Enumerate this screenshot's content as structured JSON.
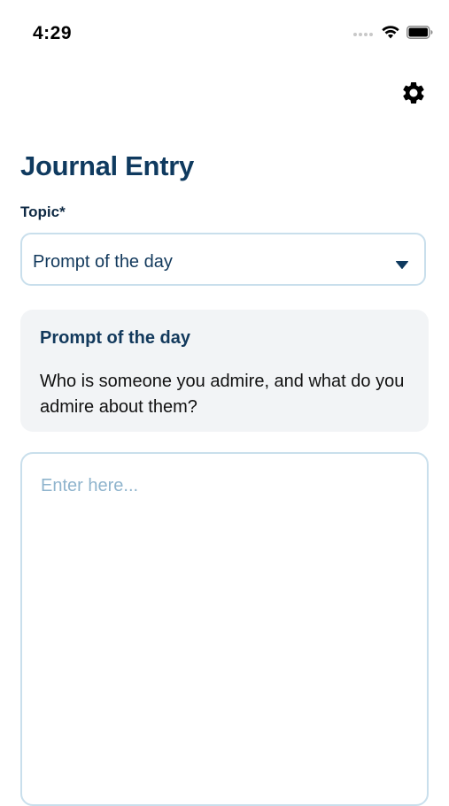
{
  "status_bar": {
    "time": "4:29",
    "icons": [
      "signal-dots-icon",
      "wifi-icon",
      "battery-icon"
    ]
  },
  "header": {
    "settings_icon": "gear-icon"
  },
  "page": {
    "title": "Journal Entry"
  },
  "topic": {
    "label": "Topic*",
    "selected_value": "Prompt of the day",
    "caret_icon": "caret-down-icon"
  },
  "prompt_card": {
    "title": "Prompt of the day",
    "text": "Who is someone you admire, and what do you admire about them?"
  },
  "entry": {
    "placeholder": "Enter here..."
  },
  "colors": {
    "primary": "#0f3a5f",
    "border": "#c9dfec",
    "card_bg": "#f2f4f6",
    "placeholder": "#8fb4cd"
  }
}
